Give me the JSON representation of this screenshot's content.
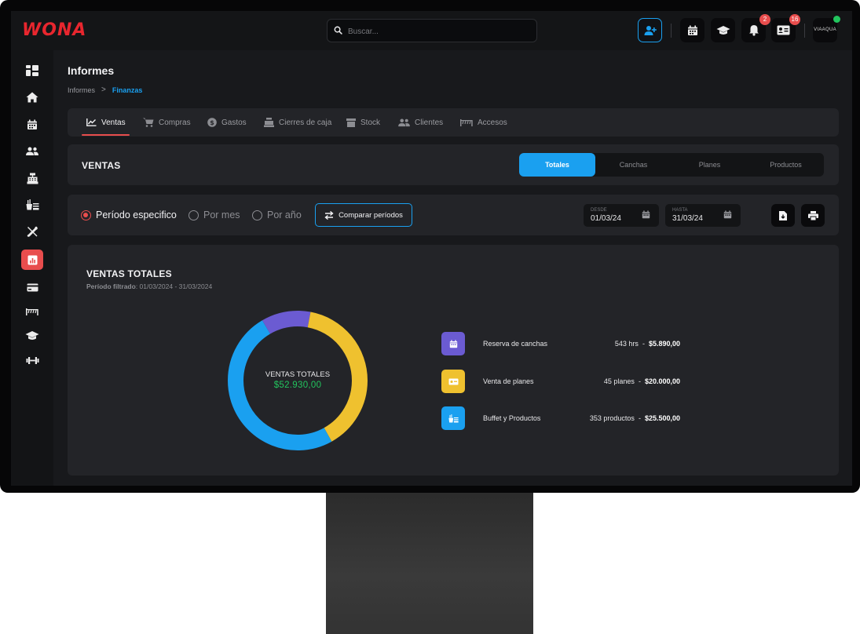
{
  "app": {
    "logo": "WONA"
  },
  "topbar": {
    "search_placeholder": "Buscar...",
    "notifications_count": "2",
    "messages_count": "16",
    "avatar_text": "VIAAQUA"
  },
  "page": {
    "title": "Informes",
    "breadcrumb": {
      "parent": "Informes",
      "separator": ">",
      "current": "Finanzas"
    }
  },
  "tabs": [
    {
      "label": "Ventas",
      "icon": "trend-icon",
      "active": true
    },
    {
      "label": "Compras",
      "icon": "cart-icon"
    },
    {
      "label": "Gastos",
      "icon": "dollar-icon"
    },
    {
      "label": "Cierres de caja",
      "icon": "register-icon"
    },
    {
      "label": "Stock",
      "icon": "box-icon"
    },
    {
      "label": "Clientes",
      "icon": "users-icon"
    },
    {
      "label": "Accesos",
      "icon": "turnstile-icon"
    }
  ],
  "section": {
    "title": "VENTAS",
    "segments": [
      "Totales",
      "Canchas",
      "Planes",
      "Productos"
    ],
    "active_segment": "Totales"
  },
  "filters": {
    "radios": [
      "Período especifico",
      "Por mes",
      "Por año"
    ],
    "selected": "Período especifico",
    "compare_label": "Comparar períodos",
    "from_label": "DESDE",
    "from_value": "01/03/24",
    "to_label": "HASTA",
    "to_value": "31/03/24"
  },
  "chart": {
    "title": "VENTAS TOTALES",
    "period_label": "Período filtrado",
    "period_value": ": 01/03/2024 - 31/03/2024",
    "center_label": "VENTAS TOTALES",
    "center_value": "$52.930,00"
  },
  "chart_data": {
    "type": "pie",
    "title": "VENTAS TOTALES",
    "categories": [
      "Reserva de canchas",
      "Venta de planes",
      "Buffet y Productos"
    ],
    "values": [
      5890,
      20000,
      25500
    ],
    "colors": [
      "#6b5bd2",
      "#efc12f",
      "#1aa0f0"
    ],
    "total": "$52.930,00"
  },
  "legend": [
    {
      "name": "Reserva de canchas",
      "qty": "543 hrs",
      "sep": "-",
      "amount": "$5.890,00",
      "color": "#6b5bd2",
      "icon": "calendar-icon"
    },
    {
      "name": "Venta de planes",
      "qty": "45 planes",
      "sep": "-",
      "amount": "$20.000,00",
      "color": "#efc12f",
      "icon": "card-icon"
    },
    {
      "name": "Buffet y Productos",
      "qty": "353 productos",
      "sep": "-",
      "amount": "$25.500,00",
      "color": "#1aa0f0",
      "icon": "buffet-icon"
    }
  ],
  "colors": {
    "accent": "#1aa0f0",
    "brand": "#e8262e",
    "active_nav": "#e84d4d",
    "positive": "#22c55e"
  }
}
